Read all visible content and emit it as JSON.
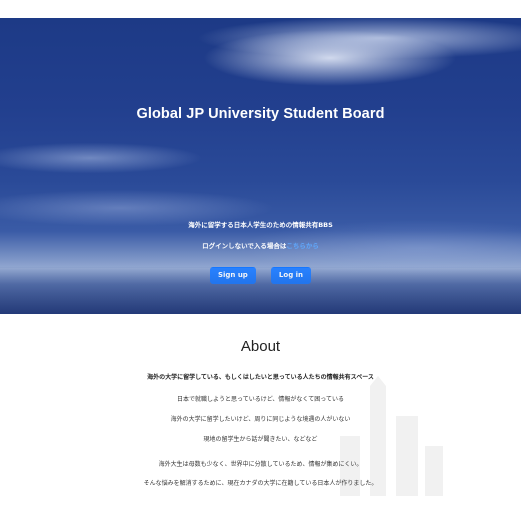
{
  "hero": {
    "title": "Global JP University Student Board",
    "line1": "海外に留学する日本人学生のための情報共有BBS",
    "line2_prefix": "ログインしないで入る場合は",
    "line2_link": "こちらから",
    "signup_label": "Sign up",
    "login_label": "Log in"
  },
  "about": {
    "title": "About",
    "lines": [
      "海外の大学に留学している、もしくはしたいと思っている人たちの情報共有スペース",
      "日本で就職しようと思っているけど、情報がなくて困っている",
      "海外の大学に留学したいけど、周りに同じような境遇の人がいない",
      "現地の留学生から話が聞きたい、などなど",
      "海外大生は母数も少なく、世界中に分散しているため、情報が集めにくい。",
      "そんな悩みを解消するために、現在カナダの大学に在籍している日本人が作りました。"
    ]
  },
  "colors": {
    "button": "#1677ff",
    "link": "#5fa9ff",
    "hero_sky": "#223f8e"
  }
}
